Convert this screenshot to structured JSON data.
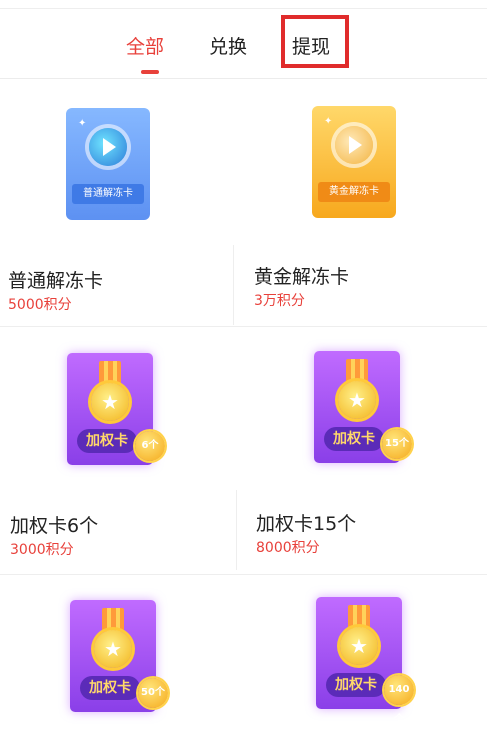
{
  "tabs": [
    {
      "label": "全部",
      "active": true
    },
    {
      "label": "兑换",
      "active": false
    },
    {
      "label": "提现",
      "active": false
    }
  ],
  "accent_color": "#e8413b",
  "highlight_color": "#e02b2b",
  "items": [
    {
      "title": "普通解冻卡",
      "price": "5000积分",
      "art_label": "普通解冻卡",
      "art": "blue-play-card-icon"
    },
    {
      "title": "黄金解冻卡",
      "price": "3万积分",
      "art_label": "黄金解冻卡",
      "art": "gold-play-card-icon"
    },
    {
      "title": "加权卡6个",
      "price": "3000积分",
      "art_label": "加权卡",
      "badge": "6个",
      "art": "medal-card-icon"
    },
    {
      "title": "加权卡15个",
      "price": "8000积分",
      "art_label": "加权卡",
      "badge": "15个",
      "art": "medal-card-icon"
    },
    {
      "title": "",
      "price": "",
      "art_label": "加权卡",
      "badge": "50个",
      "art": "medal-card-icon"
    },
    {
      "title": "",
      "price": "",
      "art_label": "加权卡",
      "badge": "140个",
      "art": "medal-card-icon"
    }
  ]
}
